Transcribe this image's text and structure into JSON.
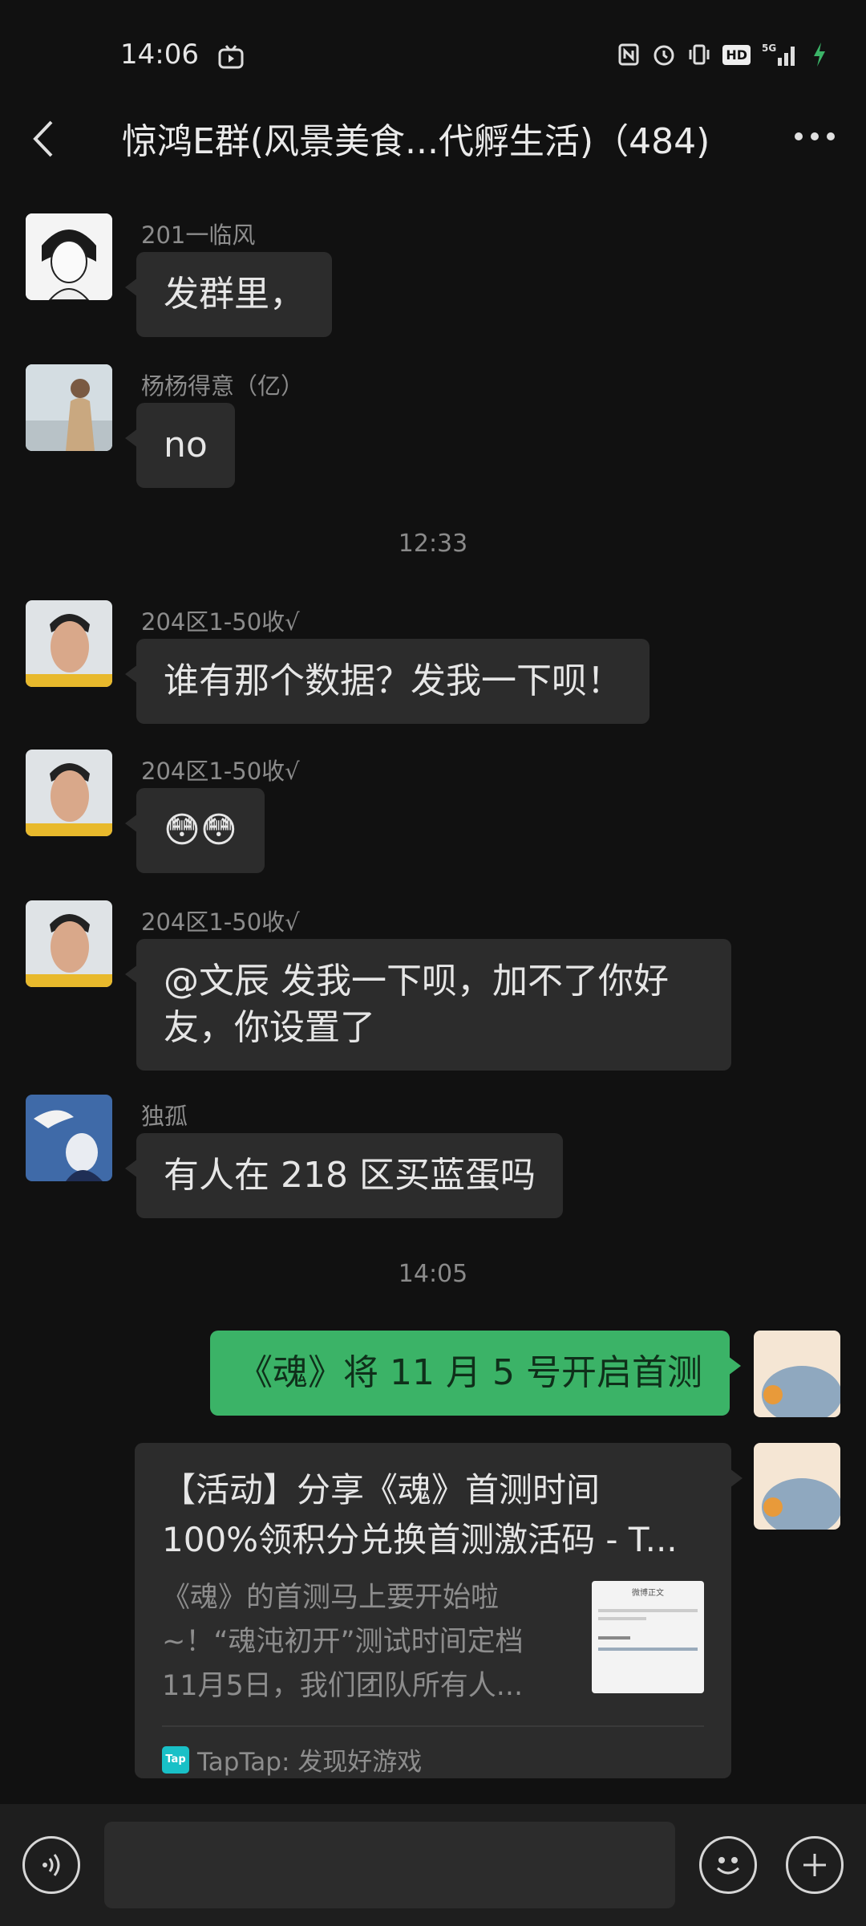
{
  "status_bar": {
    "time": "14:06",
    "icons": [
      "tv-icon",
      "nfc-icon",
      "alarm-icon",
      "vibrate-icon",
      "hd-icon",
      "5g-signal-icon",
      "charging-icon"
    ],
    "hd_label": "HD",
    "network_label": "5G"
  },
  "header": {
    "title": "惊鸿E群(风景美食...代孵生活)（484)",
    "back_icon": "back-arrow-icon",
    "more_icon": "more-icon"
  },
  "messages": [
    {
      "sender": "201一临风",
      "text": "发群里，",
      "avatar": "avatar-anime"
    },
    {
      "sender": "杨杨得意（亿）",
      "text": "no",
      "avatar": "avatar-photo"
    },
    {
      "timestamp": "12:33"
    },
    {
      "sender": "204区1-50收√",
      "text": "谁有那个数据？发我一下呗！",
      "avatar": "avatar-man"
    },
    {
      "sender": "204区1-50收√",
      "text": "😳😳",
      "avatar": "avatar-man"
    },
    {
      "sender": "204区1-50收√",
      "text": "@文辰  发我一下呗，加不了你好友，你设置了",
      "line1": "@文辰  发我一下呗，加不了你好",
      "line2": "友，你设置了",
      "avatar": "avatar-man"
    },
    {
      "sender": "独孤",
      "text": "有人在 218 区买蓝蛋吗",
      "avatar": "avatar-dove"
    },
    {
      "timestamp": "14:05"
    },
    {
      "sender": "me",
      "text": "《魂》将 11 月 5 号开启首测",
      "avatar": "avatar-self"
    }
  ],
  "link_card": {
    "title_line1": "【活动】分享《魂》首测时间",
    "title_line2": "100%领积分兑换首测激活码 - T...",
    "desc_line1": "《魂》的首测马上要开始啦",
    "desc_line2": "~！“魂沌初开”测试时间定档",
    "desc_line3": "11月5日，我们团队所有人...",
    "source": "TapTap: 发现好游戏",
    "source_logo": "Tap",
    "thumb_header": "微博正文"
  },
  "input_bar": {
    "voice_icon": "voice-icon",
    "placeholder": "",
    "emoji_icon": "emoji-icon",
    "plus_icon": "plus-icon"
  },
  "colors": {
    "background": "#111111",
    "bubble_other": "#2c2c2c",
    "bubble_self": "#3bb367",
    "input_bar": "#1e1e1e"
  }
}
